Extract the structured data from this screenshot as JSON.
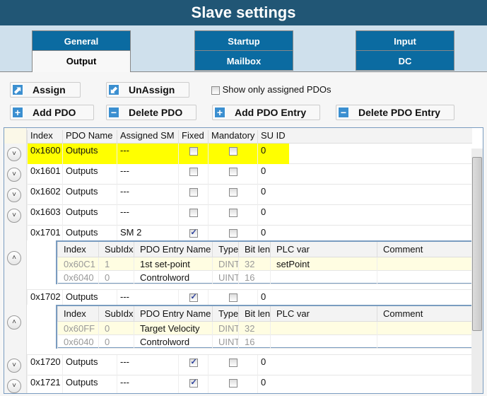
{
  "title": "Slave settings",
  "tabs": {
    "general": "General",
    "output": "Output",
    "startup": "Startup",
    "mailbox": "Mailbox",
    "input": "Input",
    "dc": "DC",
    "active": "Output"
  },
  "toolbar": {
    "assign": "Assign",
    "unassign": "UnAssign",
    "show_only_assigned": "Show only assigned PDOs",
    "show_only_assigned_checked": false,
    "add_pdo": "Add PDO",
    "delete_pdo": "Delete PDO",
    "add_pdo_entry": "Add PDO Entry",
    "delete_pdo_entry": "Delete PDO Entry"
  },
  "grid": {
    "columns": [
      "Index",
      "PDO Name",
      "Assigned SM",
      "Fixed",
      "Mandatory",
      "SU ID"
    ],
    "sub_columns": [
      "Index",
      "SubIdx",
      "PDO Entry Name",
      "Type",
      "Bit len",
      "PLC var",
      "Comment"
    ],
    "highlight_color": "#ffff00",
    "rows": [
      {
        "index": "0x1600",
        "name": "Outputs",
        "sm": "---",
        "fixed": false,
        "mandatory": false,
        "su": "0",
        "expanded": false,
        "selected": true
      },
      {
        "index": "0x1601",
        "name": "Outputs",
        "sm": "---",
        "fixed": false,
        "mandatory": false,
        "su": "0",
        "expanded": false
      },
      {
        "index": "0x1602",
        "name": "Outputs",
        "sm": "---",
        "fixed": false,
        "mandatory": false,
        "su": "0",
        "expanded": false
      },
      {
        "index": "0x1603",
        "name": "Outputs",
        "sm": "---",
        "fixed": false,
        "mandatory": false,
        "su": "0",
        "expanded": false
      },
      {
        "index": "0x1701",
        "name": "Outputs",
        "sm": "SM 2",
        "fixed": true,
        "mandatory": false,
        "su": "0",
        "expanded": true,
        "entries": [
          [
            "0x60C1",
            "1",
            "1st set-point",
            "DINT",
            "32",
            "setPoint",
            ""
          ],
          [
            "0x6040",
            "0",
            "Controlword",
            "UINT",
            "16",
            "",
            ""
          ]
        ]
      },
      {
        "index": "0x1702",
        "name": "Outputs",
        "sm": "---",
        "fixed": true,
        "mandatory": false,
        "su": "0",
        "expanded": true,
        "entries": [
          [
            "0x60FF",
            "0",
            "Target Velocity",
            "DINT",
            "32",
            "",
            ""
          ],
          [
            "0x6040",
            "0",
            "Controlword",
            "UINT",
            "16",
            "",
            ""
          ]
        ]
      },
      {
        "index": "0x1720",
        "name": "Outputs",
        "sm": "---",
        "fixed": true,
        "mandatory": false,
        "su": "0",
        "expanded": false
      },
      {
        "index": "0x1721",
        "name": "Outputs",
        "sm": "---",
        "fixed": true,
        "mandatory": false,
        "su": "0",
        "expanded": false
      }
    ]
  }
}
